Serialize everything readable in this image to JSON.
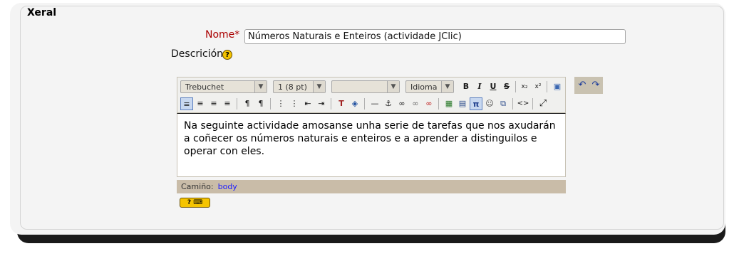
{
  "form": {
    "section_title": "Xeral",
    "name_label": "Nome",
    "required_marker": "*",
    "name_value": "Números Naturais e Enteiros (actividade JClic)",
    "description_label": "Descrición",
    "help_glyph": "?"
  },
  "editor": {
    "font_family_value": "Trebuchet",
    "font_size_value": "1 (8 pt)",
    "format_value": "",
    "language_value": "Idioma",
    "content_text": "Na seguinte actividade amosanse unha serie de tarefas que nos axudarán a coñecer os números naturais e enteiros e a aprender a distinguilos e operar con eles.",
    "path_label": "Camiño:",
    "path_value": "body",
    "buttons_row1": [
      {
        "name": "bold-button",
        "glyph": "B"
      },
      {
        "name": "italic-button",
        "glyph": "I"
      },
      {
        "name": "underline-button",
        "glyph": "U"
      },
      {
        "name": "strikethrough-button",
        "glyph": "S"
      },
      {
        "name": "subscript-button",
        "glyph": "x₂"
      },
      {
        "name": "superscript-button",
        "glyph": "x²"
      },
      {
        "name": "cleanup-button",
        "glyph": "▣"
      },
      {
        "name": "undo-button",
        "glyph": "↶"
      },
      {
        "name": "redo-button",
        "glyph": "↷"
      }
    ],
    "buttons_row2": [
      {
        "name": "align-left-button",
        "glyph": "≡"
      },
      {
        "name": "align-center-button",
        "glyph": "≡"
      },
      {
        "name": "align-right-button",
        "glyph": "≡"
      },
      {
        "name": "justify-button",
        "glyph": "≡"
      },
      {
        "name": "ltr-button",
        "glyph": "¶"
      },
      {
        "name": "rtl-button",
        "glyph": "¶"
      },
      {
        "name": "ordered-list-button",
        "glyph": "⋮"
      },
      {
        "name": "unordered-list-button",
        "glyph": "⋮"
      },
      {
        "name": "outdent-button",
        "glyph": "⇤"
      },
      {
        "name": "indent-button",
        "glyph": "⇥"
      },
      {
        "name": "text-color-button",
        "glyph": "T"
      },
      {
        "name": "bg-color-button",
        "glyph": "◈"
      },
      {
        "name": "horizontal-rule-button",
        "glyph": "—"
      },
      {
        "name": "anchor-button",
        "glyph": "⚓"
      },
      {
        "name": "link-button",
        "glyph": "∞"
      },
      {
        "name": "unlink-button",
        "glyph": "∞"
      },
      {
        "name": "nolink-button",
        "glyph": "∞"
      },
      {
        "name": "image-button",
        "glyph": "▦"
      },
      {
        "name": "table-button",
        "glyph": "▤"
      },
      {
        "name": "special-char-button",
        "glyph": "π"
      },
      {
        "name": "smiley-button",
        "glyph": "☺"
      },
      {
        "name": "search-replace-button",
        "glyph": "⧉"
      },
      {
        "name": "html-source-button",
        "glyph": "<>"
      },
      {
        "name": "fullscreen-button",
        "glyph": "⤢"
      }
    ]
  },
  "shortcuts": {
    "help_label": "?",
    "kbd_glyph": "⌨"
  }
}
